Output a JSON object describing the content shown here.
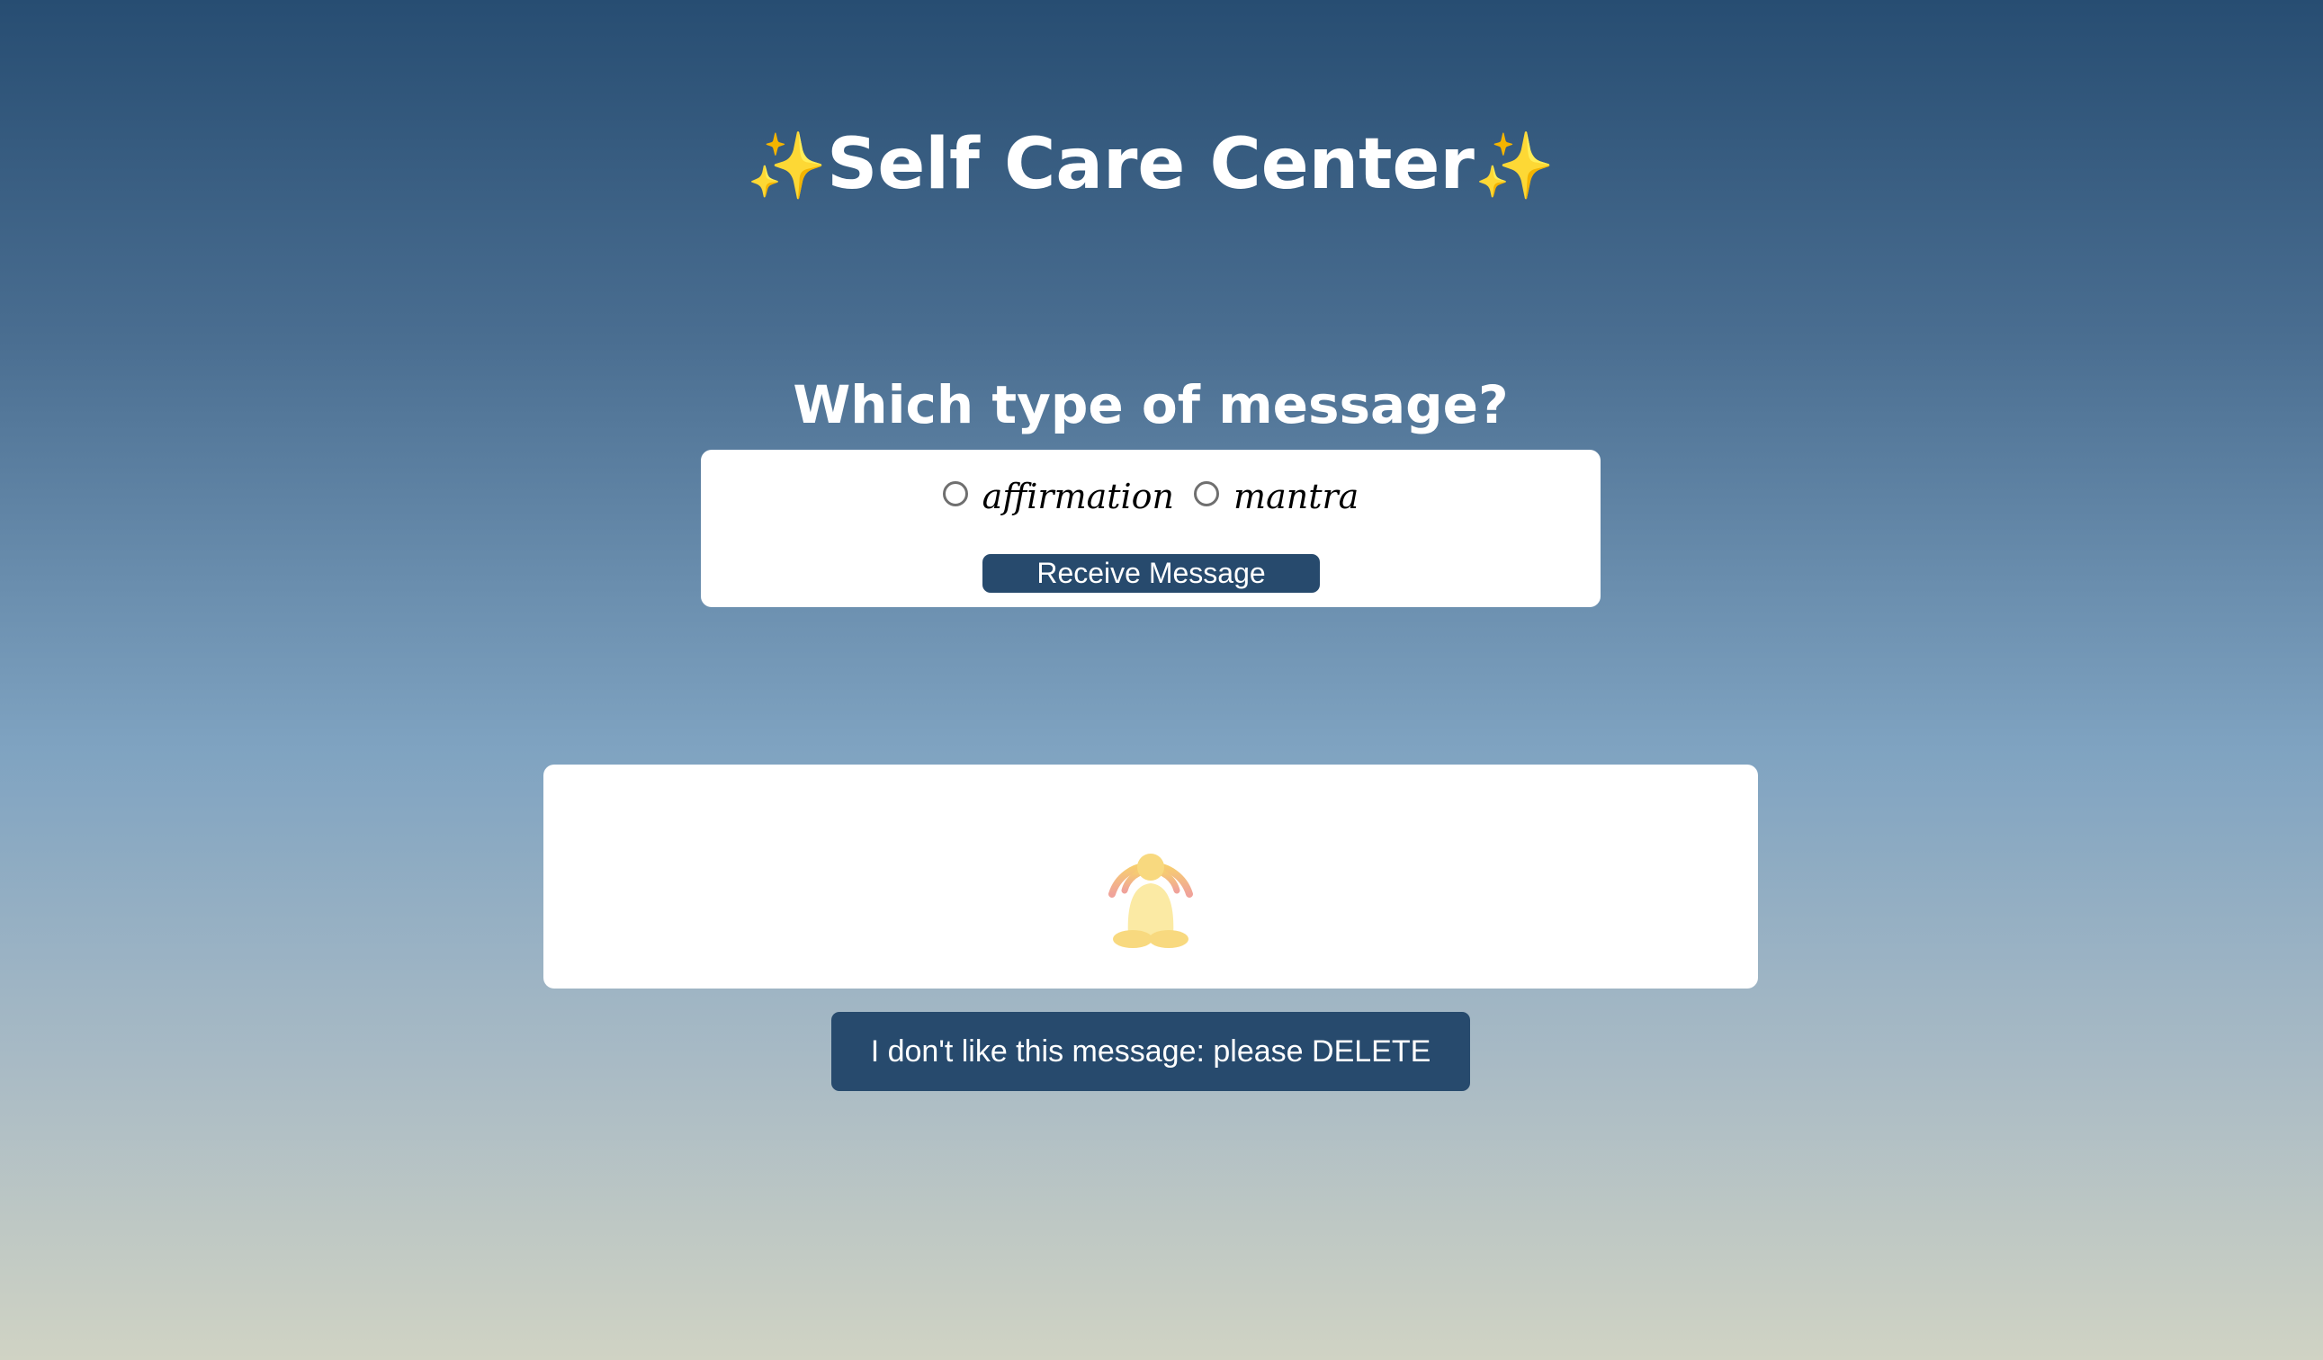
{
  "header": {
    "sparkle_left": "✨",
    "title": "Self Care Center",
    "sparkle_right": "✨"
  },
  "form": {
    "question": "Which type of message?",
    "options": [
      {
        "label": "affirmation",
        "selected": false
      },
      {
        "label": "mantra",
        "selected": false
      }
    ],
    "submit_label": "Receive Message"
  },
  "message": {
    "icon": "meditate-icon",
    "text": ""
  },
  "delete_label": "I don't like this message: please DELETE",
  "colors": {
    "button": "#274a6d",
    "background_top": "#274d72",
    "background_bottom": "#d0d3c4",
    "sparkle": "#f5cd4a"
  }
}
